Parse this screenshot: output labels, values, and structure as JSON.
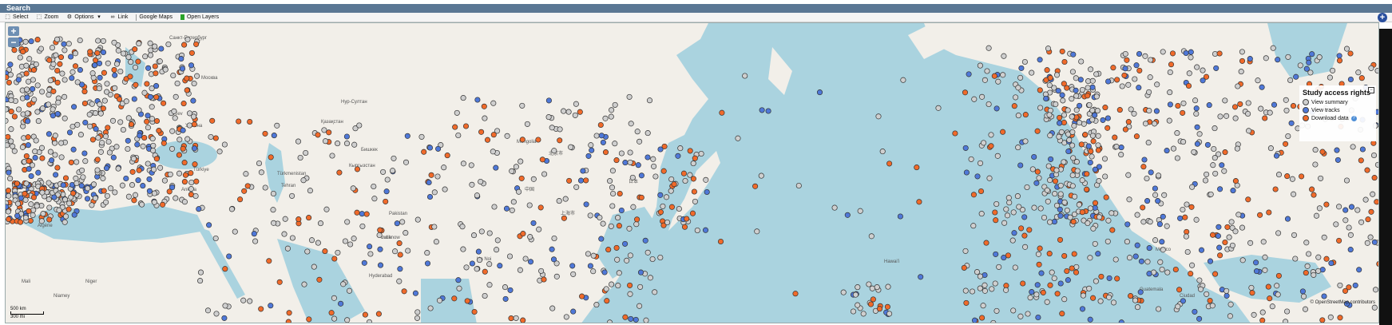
{
  "header": {
    "title": "Search"
  },
  "toolbar": {
    "select": "Select",
    "zoom": "Zoom",
    "options": "Options",
    "link": "Link",
    "google_maps": "Google Maps",
    "open_layers": "Open Layers"
  },
  "zoom_controls": {
    "in": "+",
    "out": "−"
  },
  "legend": {
    "title": "Study access rights",
    "items": [
      {
        "label": "View summary",
        "color": "#cfcfcf"
      },
      {
        "label": "View tracks",
        "color": "#4f78d8"
      },
      {
        "label": "Download data",
        "color": "#f06a2a"
      }
    ],
    "help": "?"
  },
  "scale": {
    "km": "500 km",
    "mi": "300 mi"
  },
  "attribution": "© OpenStreetMap contributors",
  "place_labels": [
    "Санкт-Петербург",
    "Москва",
    "Україна",
    "Kiev",
    "Türkiye",
    "Ankara",
    "Нур-Султан",
    "Қазақстан",
    "Бишкек",
    "Кыргызстан",
    "Türkmenistan",
    "Tehran",
    "Pakistan",
    "India",
    "Hyderabad",
    "Lucknow",
    "Ha Noi",
    "Mongolia",
    "北京市",
    "中国",
    "上海市",
    "日本",
    "Algérie",
    "Mali",
    "Niger",
    "Niamey",
    "México",
    "Guatemala",
    "Ciudad",
    "Hawaiʻi"
  ],
  "colors": {
    "water": "#aad3df",
    "land": "#f2efe9",
    "view_summary": "#cfcfcf",
    "view_tracks": "#4f78d8",
    "download": "#f06a2a"
  }
}
